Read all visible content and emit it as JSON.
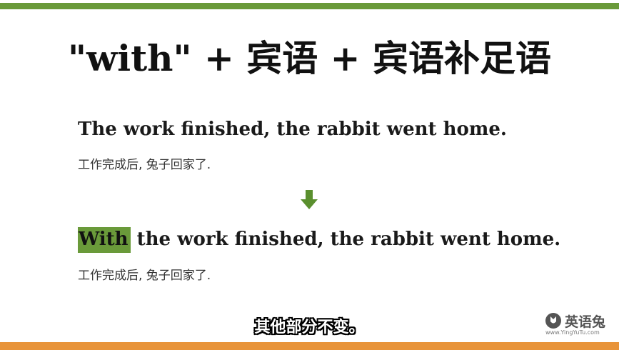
{
  "colors": {
    "top_bar": "#6a9a3a",
    "bottom_bar": "#e8943a",
    "highlight": "#6a9a3a",
    "arrow": "#5a8f2e"
  },
  "slide": {
    "title": "\"with\" + 宾语 + 宾语补足语",
    "sentence1": "The work finished, the rabbit went home.",
    "translation1": "工作完成后, 兔子回家了.",
    "arrow_icon": "arrow-down-icon",
    "sentence2_highlight": "With",
    "sentence2_rest": " the work finished, the rabbit went home.",
    "translation2": "工作完成后, 兔子回家了."
  },
  "subtitle": "其他部分不变。",
  "logo": {
    "name": "英语兔",
    "url": "www.YingYuTu.com",
    "icon": "rabbit-logo-icon"
  }
}
